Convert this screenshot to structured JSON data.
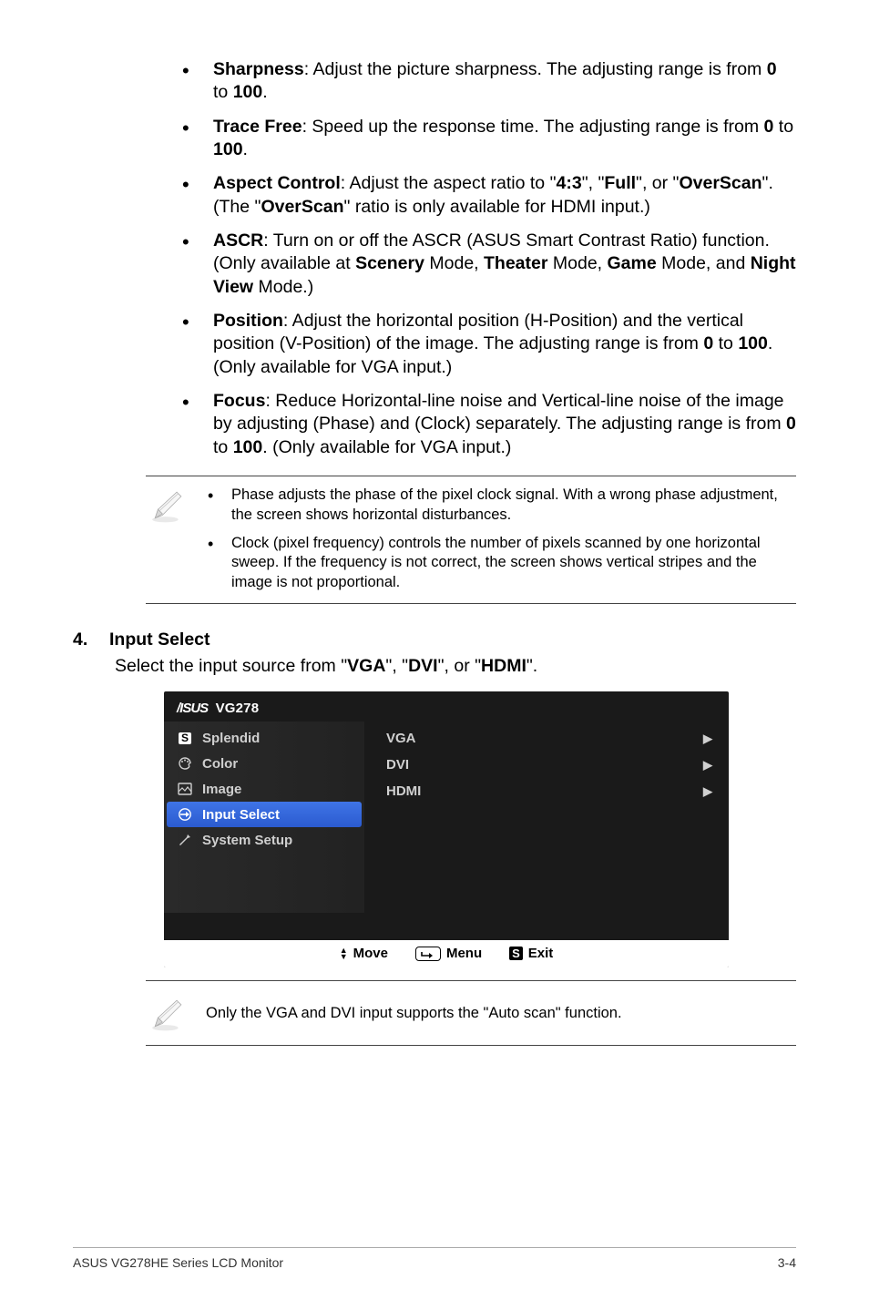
{
  "bullets": {
    "sharpness": {
      "title": "Sharpness",
      "body": ": Adjust the picture sharpness. The adjusting range is from ",
      "range_from": "0",
      "range_to": "100",
      "suffix": "."
    },
    "trace_free": {
      "title": "Trace Free",
      "body": ": Speed up the response time. The adjusting range is from ",
      "range_from": "0",
      "range_to": "100",
      "suffix": "."
    },
    "aspect_control": {
      "title": "Aspect Control",
      "body_pre": ": Adjust the aspect ratio to \"",
      "opt1": "4:3",
      "mid1": "\", \"",
      "opt2": "Full",
      "mid2": "\", or \"",
      "opt3": "OverScan",
      "mid3": "\". (The \"",
      "opt4": "OverScan",
      "body_post": "\" ratio is only available for HDMI input.)"
    },
    "ascr": {
      "title": "ASCR",
      "body_pre": ": Turn on or off the ASCR (ASUS Smart Contrast Ratio) function. (Only available at ",
      "m1": "Scenery",
      "s1": " Mode, ",
      "m2": "Theater",
      "s2": " Mode, ",
      "m3": "Game",
      "s3": " Mode, and ",
      "m4": "Night View",
      "s4": " Mode.)"
    },
    "position": {
      "title": "Position",
      "body_pre": ": Adjust the horizontal position (H-Position) and the vertical position (V-Position) of the image. The adjusting range is from ",
      "range_from": "0",
      "range_to": "100",
      "body_post": ". (Only available for VGA input.)"
    },
    "focus": {
      "title": "Focus",
      "body_pre": ": Reduce Horizontal-line noise and Vertical-line noise of the image by adjusting (Phase) and (Clock) separately. The adjusting range is from ",
      "range_from": "0",
      "range_to": "100",
      "body_post": ". (Only available for VGA input.)"
    }
  },
  "note1": {
    "item1": "Phase adjusts the phase of the pixel clock signal. With a wrong phase adjustment, the screen shows horizontal disturbances.",
    "item2": "Clock (pixel frequency) controls the number of pixels scanned by one horizontal sweep. If the frequency is not correct, the screen shows vertical stripes and the image is not proportional."
  },
  "section4": {
    "num": "4.",
    "title": "Input Select",
    "intro_pre": "Select the input source from \"",
    "s1": "VGA",
    "sep1": "\", \"",
    "s2": "DVI",
    "sep2": "\", or \"",
    "s3": "HDMI",
    "post": "\"."
  },
  "osd": {
    "model": "VG278",
    "menu": {
      "splendid": "Splendid",
      "color": "Color",
      "image": "Image",
      "input_select": "Input Select",
      "system_setup": "System Setup"
    },
    "right": {
      "vga": "VGA",
      "dvi": "DVI",
      "hdmi": "HDMI"
    },
    "footer": {
      "move": "Move",
      "menu": "Menu",
      "exit": "Exit",
      "s_glyph": "S"
    }
  },
  "note2": "Only the VGA and DVI input supports the \"Auto scan\" function.",
  "footer": {
    "left": "ASUS VG278HE Series LCD Monitor",
    "right": "3-4"
  },
  "words": {
    "to": " to "
  }
}
